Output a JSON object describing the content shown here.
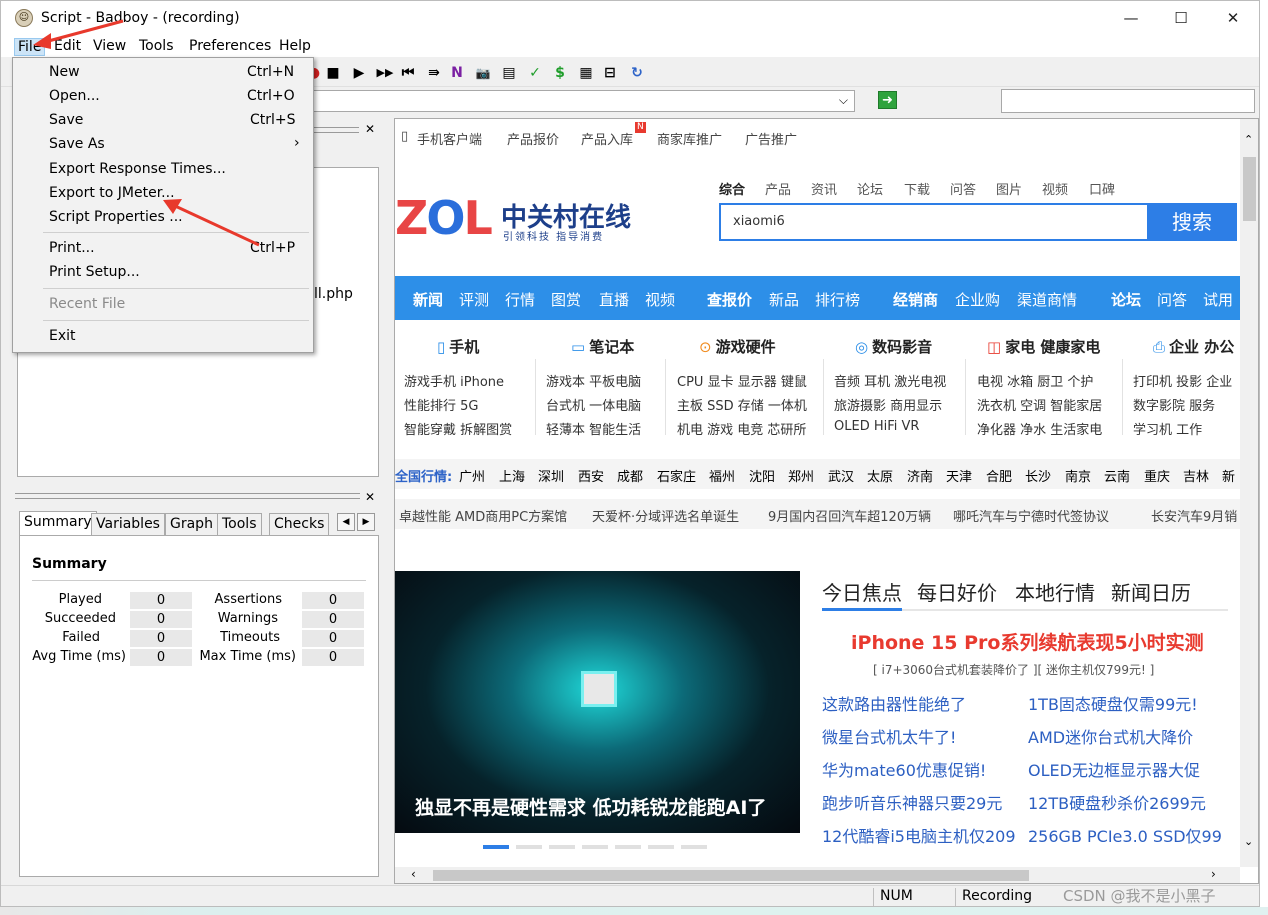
{
  "window": {
    "title": "Script - Badboy - (recording)",
    "minimize": "—",
    "maximize": "☐",
    "close": "✕"
  },
  "menubar": [
    "File",
    "Edit",
    "View",
    "Tools",
    "Preferences",
    "Help"
  ],
  "file_menu": [
    {
      "label": "New",
      "shortcut": "Ctrl+N"
    },
    {
      "label": "Open...",
      "shortcut": "Ctrl+O"
    },
    {
      "label": "Save",
      "shortcut": "Ctrl+S"
    },
    {
      "label": "Save As",
      "shortcut": "›"
    },
    {
      "label": "Export Response Times..."
    },
    {
      "label": "Export to JMeter..."
    },
    {
      "label": "Script Properties ..."
    },
    {
      "label": "Print...",
      "shortcut": "Ctrl+P"
    },
    {
      "label": "Print Setup..."
    },
    {
      "label": "Recent File",
      "disabled": true
    },
    {
      "label": "Exit"
    }
  ],
  "toolbar": {
    "buttons": [
      "●",
      "■",
      "▶",
      "▶▶",
      "⏮",
      "⇛",
      "N",
      "📷",
      "▤",
      "✓",
      "$",
      "▦",
      "⊟",
      "↻"
    ]
  },
  "address": {
    "go": "➜",
    "dropdown": "⌵"
  },
  "tree": {
    "item": "ll.php"
  },
  "summary": {
    "tabs": [
      "Summary",
      "Variables",
      "Graph",
      "Tools",
      "Checks"
    ],
    "title": "Summary",
    "left": [
      {
        "label": "Played",
        "value": "0"
      },
      {
        "label": "Succeeded",
        "value": "0"
      },
      {
        "label": "Failed",
        "value": "0"
      },
      {
        "label": "Avg Time (ms)",
        "value": "0"
      }
    ],
    "right": [
      {
        "label": "Assertions",
        "value": "0"
      },
      {
        "label": "Warnings",
        "value": "0"
      },
      {
        "label": "Timeouts",
        "value": "0"
      },
      {
        "label": "Max Time (ms)",
        "value": "0"
      }
    ]
  },
  "site": {
    "topnav": [
      "手机客户端",
      "产品报价",
      "产品入库",
      "商家库推广",
      "广告推广"
    ],
    "topnav_badge": "N",
    "logo": {
      "z": "Z",
      "o": "O",
      "l": "L",
      "name": "中关村在线",
      "slogan": "引领科技 指导消费"
    },
    "search_tabs": [
      "综合",
      "产品",
      "资讯",
      "论坛",
      "下载",
      "问答",
      "图片",
      "视频",
      "口碑"
    ],
    "search_value": "xiaomi6",
    "search_button": "搜索",
    "bluenav": [
      "新闻",
      "评测",
      "行情",
      "图赏",
      "直播",
      "视频",
      "查报价",
      "新品",
      "排行榜",
      "经销商",
      "企业购",
      "渠道商情",
      "论坛",
      "问答",
      "试用"
    ],
    "categories": [
      {
        "icon": "▯",
        "title": "手机",
        "lines": [
          "游戏手机  iPhone",
          "性能排行  5G",
          "智能穿戴  拆解图赏"
        ]
      },
      {
        "icon": "▭",
        "title": "笔记本",
        "lines": [
          "游戏本  平板电脑",
          "台式机  一体电脑",
          "轻薄本  智能生活"
        ]
      },
      {
        "icon": "⊙",
        "title": "游戏硬件",
        "lines": [
          "CPU 显卡  显示器 键鼠",
          "主板 SSD  存储 一体机",
          "机电 游戏  电竞 芯研所"
        ]
      },
      {
        "icon": "◎",
        "title": "数码影音",
        "lines": [
          "音频 耳机  激光电视",
          "旅游摄影  商用显示",
          "OLED      HiFi  VR"
        ]
      },
      {
        "icon": "◫",
        "title": "家电  健康家电",
        "lines": [
          "电视 冰箱    厨卫 个护",
          "洗衣机 空调  智能家居",
          "净化器 净水  生活家电"
        ]
      },
      {
        "icon": "⎙",
        "title": "企业 办公",
        "lines": [
          "打印机 投影 企业",
          "数字影院    服务",
          "学习机      工作"
        ]
      }
    ],
    "cities": [
      "全国行情:",
      "广州",
      "上海",
      "深圳",
      "西安",
      "成都",
      "石家庄",
      "福州",
      "沈阳",
      "郑州",
      "武汉",
      "太原",
      "济南",
      "天津",
      "合肥",
      "长沙",
      "南京",
      "云南",
      "重庆",
      "吉林",
      "新"
    ],
    "news": [
      "卓越性能 AMD商用PC方案馆",
      "天爱杯·分域评选名单诞生",
      "9月国内召回汽车超120万辆",
      "哪吒汽车与宁德时代签协议",
      "长安汽车9月销"
    ],
    "banner_text": "独显不再是硬性需求 低功耗锐龙能跑AI了",
    "focus_tabs": [
      "今日焦点",
      "每日好价",
      "本地行情",
      "新闻日历"
    ],
    "headline": "iPhone 15 Pro系列续航表现5小时实测",
    "subhead": "[ i7+3060台式机套装降价了 ][ 迷你主机仅799元! ]",
    "links_left": [
      "这款路由器性能绝了",
      "微星台式机太牛了!",
      "华为mate60优惠促销!",
      "跑步听音乐神器只要29元",
      "12代酷睿i5电脑主机仅209"
    ],
    "links_right": [
      "1TB固态硬盘仅需99元!",
      "AMD迷你台式机大降价",
      "OLED无边框显示器大促",
      "12TB硬盘秒杀价2699元",
      "256GB PCIe3.0 SSD仅99"
    ]
  },
  "statusbar": {
    "num": "NUM",
    "recording": "Recording"
  },
  "watermark": "CSDN @我不是小黑子",
  "colors": {
    "accent_blue": "#2d8fe8",
    "headline_red": "#e83a2f",
    "link_blue": "#2c5fc2",
    "arrow_red": "#e8392c"
  }
}
